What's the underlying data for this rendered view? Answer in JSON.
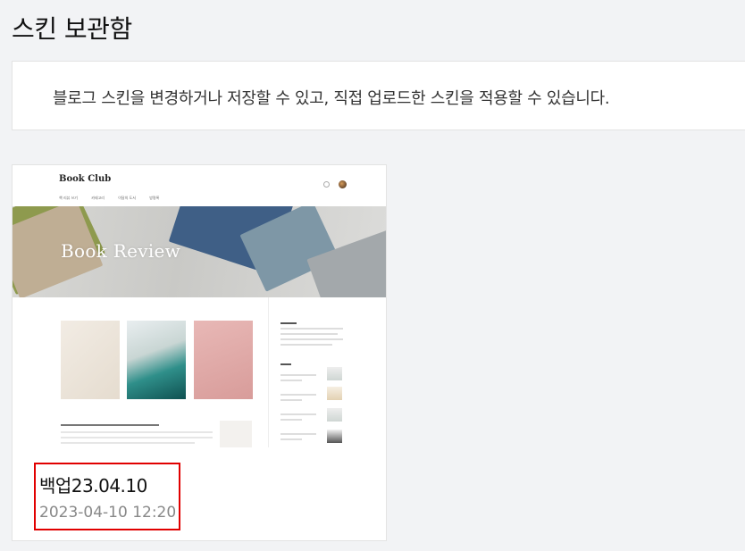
{
  "page": {
    "title": "스킨 보관함",
    "description": "블로그 스킨을 변경하거나 저장할 수 있고, 직접 업로드한 스킨을 적용할 수 있습니다."
  },
  "skins": [
    {
      "name": "백업23.04.10",
      "date": "2023-04-10 12:20",
      "preview": {
        "blog_name": "Book Club",
        "hero_title": "Book Review",
        "nav": [
          "책 리뷰 쓰기",
          "카테고리",
          "이달의 도서",
          "방명록"
        ]
      }
    }
  ],
  "colors": {
    "background": "#f2f3f5",
    "highlight_border": "#e10000",
    "date_text": "#888888"
  }
}
